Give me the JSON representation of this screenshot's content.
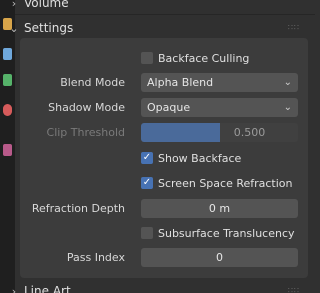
{
  "sections": {
    "volume": {
      "label": "Volume"
    },
    "settings": {
      "label": "Settings"
    },
    "line_art": {
      "label": "Line Art"
    }
  },
  "settings": {
    "backface_culling": {
      "label": "Backface Culling",
      "checked": false
    },
    "blend_mode": {
      "label": "Blend Mode",
      "value": "Alpha Blend"
    },
    "shadow_mode": {
      "label": "Shadow Mode",
      "value": "Opaque"
    },
    "clip_threshold": {
      "label": "Clip Threshold",
      "value": "0.500",
      "fraction": 0.5
    },
    "show_backface": {
      "label": "Show Backface",
      "checked": true
    },
    "screen_space_refraction": {
      "label": "Screen Space Refraction",
      "checked": true
    },
    "refraction_depth": {
      "label": "Refraction Depth",
      "value": "0 m"
    },
    "subsurface_translucency": {
      "label": "Subsurface Translucency",
      "checked": false
    },
    "pass_index": {
      "label": "Pass Index",
      "value": "0"
    }
  },
  "icons": {
    "collapsed": "chevron-right-icon",
    "expanded": "chevron-down-icon",
    "checkmark": "checkmark-icon",
    "dropdown": "chevron-down-icon",
    "grip": "drag-grip-icon"
  },
  "colors": {
    "accent": "#4772b3",
    "slider_fill": "#4a6a9a",
    "panel_bg": "#3c3c3c",
    "field_bg": "#545454"
  }
}
